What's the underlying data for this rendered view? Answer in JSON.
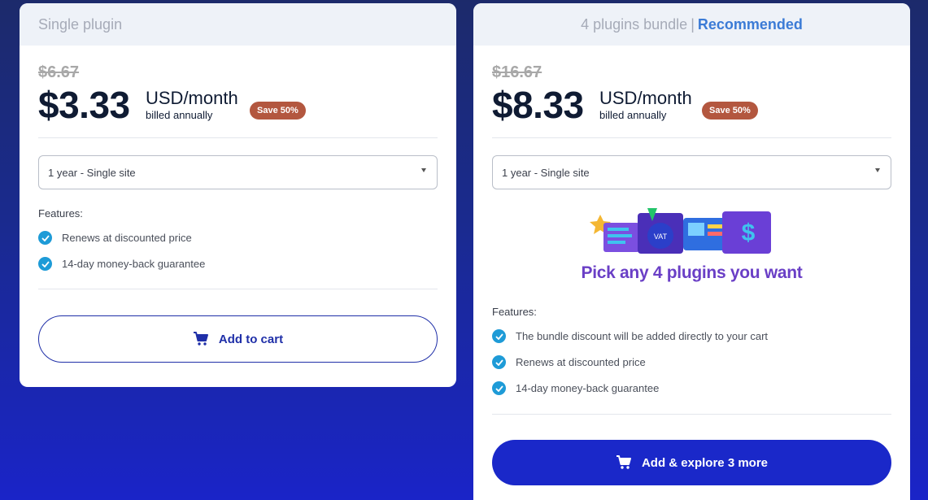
{
  "single": {
    "header": "Single plugin",
    "old_price": "$6.67",
    "price": "$3.33",
    "unit": "USD/month",
    "billed": "billed annually",
    "save_badge": "Save 50%",
    "license_select": "1 year - Single site",
    "features_label": "Features:",
    "features": [
      "Renews at discounted price",
      "14-day money-back guarantee"
    ],
    "cta": "Add to cart"
  },
  "bundle": {
    "header": "4 plugins bundle",
    "header_separator": "|",
    "recommended": "Recommended",
    "old_price": "$16.67",
    "price": "$8.33",
    "unit": "USD/month",
    "billed": "billed annually",
    "save_badge": "Save 50%",
    "license_select": "1 year - Single site",
    "promo_title": "Pick any 4 plugins you want",
    "features_label": "Features:",
    "features": [
      "The bundle discount will be added directly to your cart",
      "Renews at discounted price",
      "14-day money-back guarantee"
    ],
    "cta": "Add & explore 3 more"
  },
  "icons": {
    "check": "check-circle-icon",
    "cart": "cart-icon",
    "caret": "chevron-down-icon"
  },
  "colors": {
    "accent": "#1a28c9",
    "save_badge": "#b3573f",
    "check": "#1e9bd7",
    "recommended": "#3b7bd6",
    "promo": "#6a3fc6"
  }
}
